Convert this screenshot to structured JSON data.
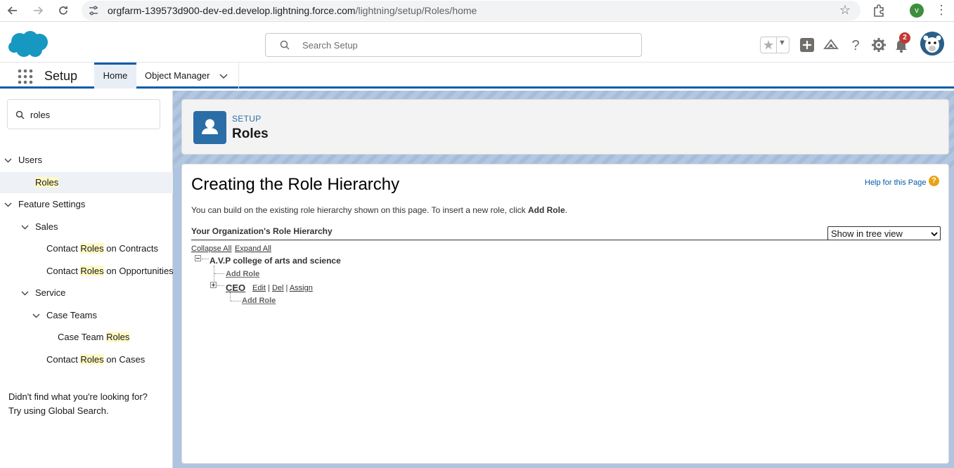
{
  "browser": {
    "url_host": "orgfarm-139573d900-dev-ed.develop.lightning.force.com",
    "url_path": "/lightning/setup/Roles/home",
    "profile_initial": "v",
    "icons": [
      "back-icon",
      "forward-icon",
      "reload-icon",
      "tune-icon",
      "star-icon",
      "extensions-icon",
      "kebab-menu-icon"
    ]
  },
  "header": {
    "search_placeholder": "Search Setup",
    "notification_count": "2",
    "icons": [
      "favorites-star-icon",
      "global-actions-plus-icon",
      "trailhead-icon",
      "help-icon",
      "setup-gear-icon",
      "notification-bell-icon"
    ]
  },
  "nav": {
    "app_name": "Setup",
    "tabs": [
      {
        "label": "Home",
        "active": true
      },
      {
        "label": "Object Manager",
        "active": false
      }
    ]
  },
  "sidebar": {
    "quickfind_value": "roles",
    "items": [
      {
        "pre": "Users",
        "hl": "",
        "post": ""
      },
      {
        "pre": "",
        "hl": "Roles",
        "post": ""
      },
      {
        "pre": "Feature Settings",
        "hl": "",
        "post": ""
      },
      {
        "pre": "Sales",
        "hl": "",
        "post": ""
      },
      {
        "pre": "Contact ",
        "hl": "Roles",
        "post": " on Contracts"
      },
      {
        "pre": "Contact ",
        "hl": "Roles",
        "post": " on Opportunities"
      },
      {
        "pre": "Service",
        "hl": "",
        "post": ""
      },
      {
        "pre": "Case Teams",
        "hl": "",
        "post": ""
      },
      {
        "pre": "Case Team ",
        "hl": "Roles",
        "post": ""
      },
      {
        "pre": "Contact ",
        "hl": "Roles",
        "post": " on Cases"
      }
    ],
    "not_found_line1": "Didn't find what you're looking for?",
    "not_found_line2": "Try using Global Search."
  },
  "page_header": {
    "eyebrow": "SETUP",
    "title": "Roles"
  },
  "content": {
    "title": "Creating the Role Hierarchy",
    "help_link": "Help for this Page",
    "desc_text": "You can build on the existing role hierarchy shown on this page. To insert a new role, click ",
    "desc_bold": "Add Role",
    "desc_end": ".",
    "section_title": "Your Organization's Role Hierarchy",
    "view_select": "Show in tree view",
    "collapse_all": "Collapse All",
    "expand_all": "Expand All",
    "root_node": "A.V.P college of arts and science",
    "add_role": "Add Role",
    "ceo_node": "CEO",
    "edit": "Edit",
    "del": "Del",
    "assign": "Assign",
    "sep": "|"
  },
  "colors": {
    "brand_blue": "#0b5cab",
    "icon_blue": "#2b6da6",
    "highlight": "#fff9c4",
    "badge_red": "#c23934"
  }
}
